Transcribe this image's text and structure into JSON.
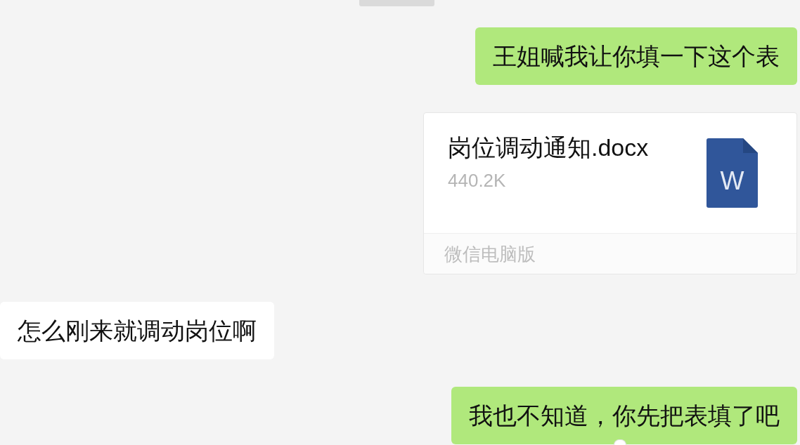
{
  "messages": [
    {
      "kind": "text",
      "outgoing": true,
      "text": "王姐喊我让你填一下这个表"
    },
    {
      "kind": "file",
      "outgoing": true,
      "file_name": "岗位调动通知.docx",
      "file_size": "440.2K",
      "icon_text": "W",
      "source": "微信电脑版"
    },
    {
      "kind": "text",
      "outgoing": false,
      "text": "怎么刚来就调动岗位啊"
    },
    {
      "kind": "text",
      "outgoing": true,
      "text": "我也不知道，你先把表填了吧"
    }
  ]
}
